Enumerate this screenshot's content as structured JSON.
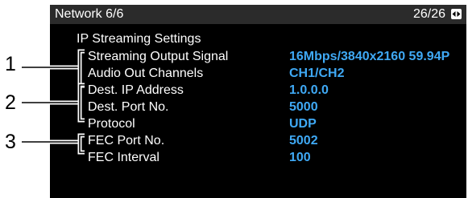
{
  "header": {
    "title": "Network 6/6",
    "page_indicator": "26/26"
  },
  "icons": {
    "scroll": "left-right-scroll-icon"
  },
  "section": {
    "title": "IP Streaming Settings"
  },
  "settings": [
    {
      "label": "Streaming Output Signal",
      "value": "16Mbps/3840x2160 59.94P"
    },
    {
      "label": "Audio Out Channels",
      "value": "CH1/CH2"
    },
    {
      "label": "Dest. IP Address",
      "value": "1.0.0.0"
    },
    {
      "label": "Dest. Port No.",
      "value": "5000"
    },
    {
      "label": "Protocol",
      "value": "UDP"
    },
    {
      "label": "FEC Port No.",
      "value": "5002"
    },
    {
      "label": "FEC Interval",
      "value": "100"
    }
  ],
  "callouts": [
    "1",
    "2",
    "3"
  ],
  "colors": {
    "screen_background": "#000000",
    "header_background": "#2b2b2b",
    "label_text": "#ffffff",
    "value_text": "#3fa9f5"
  }
}
